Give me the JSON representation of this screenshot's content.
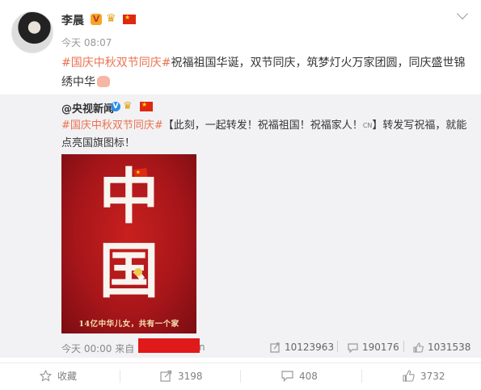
{
  "post": {
    "username": "李晨",
    "verified_badge": "V",
    "time": "今天 08:07",
    "content_topic": "#国庆中秋双节同庆#",
    "content_body": "祝福祖国华诞，双节同庆，筑梦灯火万家团圆，同庆盛世锦绣中华",
    "icons": [
      "avatar",
      "vip-badge-icon",
      "crown-icon",
      "china-flag-icon",
      "chevron-down-icon",
      "bow-emoji-icon"
    ]
  },
  "repost": {
    "username": "@央视新闻",
    "verified_badge": "V",
    "topic": "#国庆中秋双节同庆#",
    "text_before_chip": "【此刻，一起转发！祝福祖国！祝福家人！",
    "chip": "CN",
    "text_after_chip": "】转发写祝福，就能点亮国旗图标！",
    "poster": {
      "char_top": "中",
      "char_bottom": "国",
      "caption": "14亿中华儿女，共有一个家"
    },
    "time": "今天 00:00",
    "source_prefix": "来自",
    "source_tail": "n",
    "stats": {
      "reposts": "10123963",
      "comments": "190176",
      "likes": "1031538"
    }
  },
  "actions": {
    "favorite": "收藏",
    "repost": "3198",
    "comment": "408",
    "like": "3732"
  },
  "colors": {
    "topic": "#eb7350",
    "redaction": "#e01a1a",
    "repost_bg": "#f2f2f5"
  }
}
